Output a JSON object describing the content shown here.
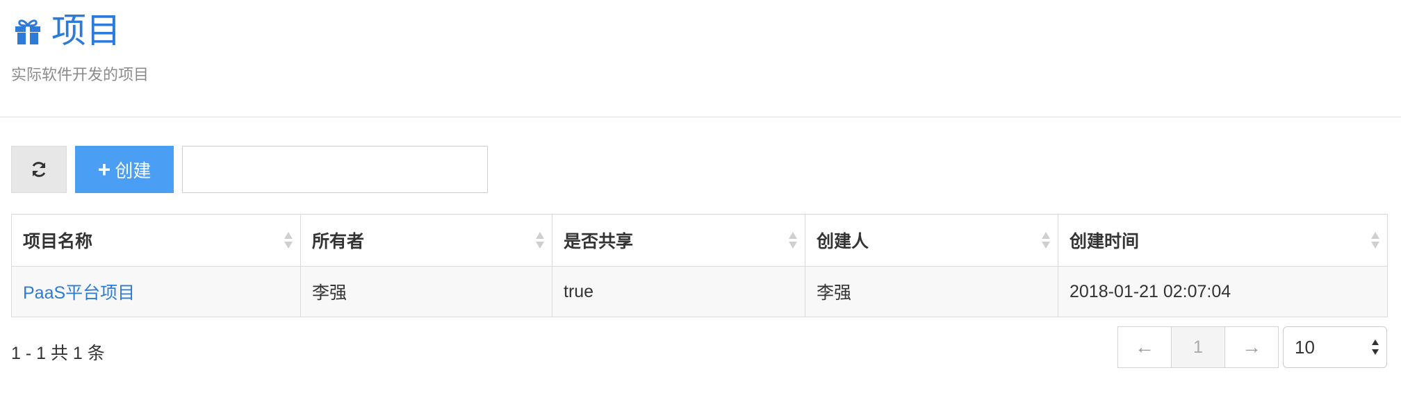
{
  "header": {
    "title": "项目",
    "subtitle": "实际软件开发的项目",
    "icon": "gift-icon"
  },
  "toolbar": {
    "refresh_icon": "refresh-icon",
    "create_label": "创建",
    "create_icon": "plus-icon",
    "search_value": "",
    "search_placeholder": ""
  },
  "table": {
    "columns": [
      "项目名称",
      "所有者",
      "是否共享",
      "创建人",
      "创建时间"
    ],
    "rows": [
      [
        "PaaS平台项目",
        "李强",
        "true",
        "李强",
        "2018-01-21 02:07:04"
      ]
    ]
  },
  "footer": {
    "info": "1 - 1 共 1 条",
    "prev": "←",
    "page": "1",
    "next": "→",
    "page_size": "10"
  },
  "colors": {
    "accent": "#2c7bd8",
    "create_button": "#4a9ff5",
    "refresh_button": "#e7e7e7"
  }
}
